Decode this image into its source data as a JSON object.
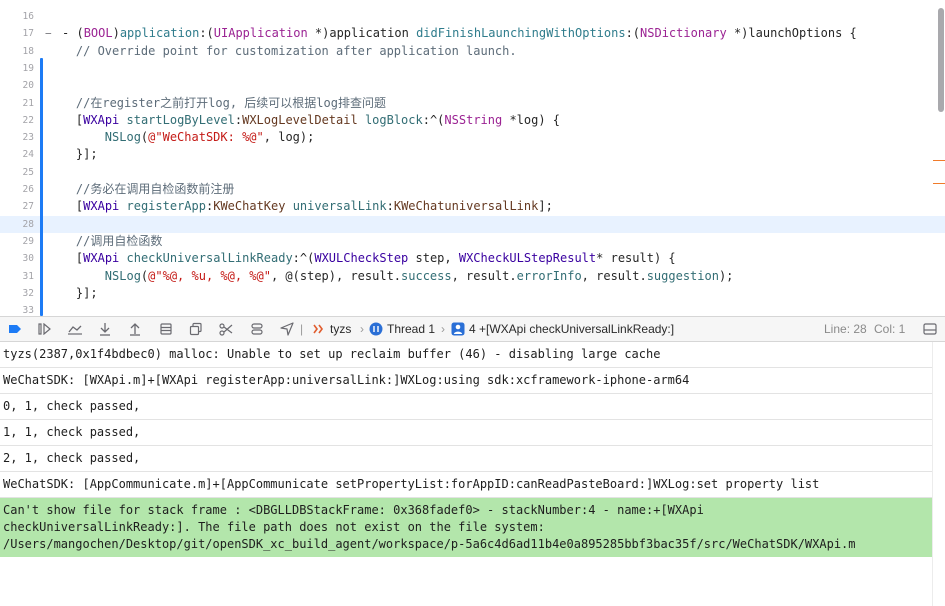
{
  "editor": {
    "lines": [
      {
        "num": "16",
        "html": ""
      },
      {
        "num": "17",
        "html": "<span class=\"p\">- (</span><span class=\"kw\">BOOL</span><span class=\"p\">)</span><span class=\"mth\">application</span><span class=\"p\">:(</span><span class=\"kw\">UIApplication</span><span class=\"p\"> *)application </span><span class=\"mth\">didFinishLaunchingWithOptions</span><span class=\"p\">:(</span><span class=\"kw\">NSDictionary</span><span class=\"p\"> *)launchOptions {</span>",
        "fold": "−"
      },
      {
        "num": "18",
        "html": "    <span class=\"cm\">// Override point for customization after application launch.</span>"
      },
      {
        "num": "19",
        "html": ""
      },
      {
        "num": "20",
        "html": ""
      },
      {
        "num": "21",
        "html": "    <span class=\"cm\">//在register之前打开log, 后续可以根据log排查问题</span>"
      },
      {
        "num": "22",
        "html": "    <span class=\"p\">[</span><span class=\"ty\">WXApi</span><span class=\"p\"> </span><span class=\"mth2\">startLogByLevel</span><span class=\"p\">:</span><span class=\"cst\">WXLogLevelDetail</span><span class=\"p\"> </span><span class=\"mth2\">logBlock</span><span class=\"p\">:^(</span><span class=\"kw\">NSString</span><span class=\"p\"> *log) {</span>"
      },
      {
        "num": "23",
        "html": "        <span class=\"mth2\">NSLog</span><span class=\"p\">(</span><span class=\"str\">@\"WeChatSDK: </span><span class=\"fmt\">%@</span><span class=\"str\">\"</span><span class=\"p\">, log);</span>"
      },
      {
        "num": "24",
        "html": "    <span class=\"p\">}];</span>"
      },
      {
        "num": "25",
        "html": ""
      },
      {
        "num": "26",
        "html": "    <span class=\"cm\">//务必在调用自检函数前注册</span>"
      },
      {
        "num": "27",
        "html": "    <span class=\"p\">[</span><span class=\"ty\">WXApi</span><span class=\"p\"> </span><span class=\"mth2\">registerApp</span><span class=\"p\">:</span><span class=\"cst\">KWeChatKey</span><span class=\"p\"> </span><span class=\"mth2\">universalLink</span><span class=\"p\">:</span><span class=\"cst\">KWeChatuniversalLink</span><span class=\"p\">];</span>"
      },
      {
        "num": "28",
        "html": "",
        "current": true
      },
      {
        "num": "29",
        "html": "    <span class=\"cm\">//调用自检函数</span>"
      },
      {
        "num": "30",
        "html": "    <span class=\"p\">[</span><span class=\"ty\">WXApi</span><span class=\"p\"> </span><span class=\"mth2\">checkUniversalLinkReady</span><span class=\"p\">:^(</span><span class=\"ty\">WXULCheckStep</span><span class=\"p\"> step, </span><span class=\"ty\">WXCheckULStepResult</span><span class=\"p\">* result) {</span>"
      },
      {
        "num": "31",
        "html": "        <span class=\"mth2\">NSLog</span><span class=\"p\">(</span><span class=\"str\">@\"%@, %u, %@, %@\"</span><span class=\"p\">, @(step), result.</span><span class=\"mth2\">success</span><span class=\"p\">, result.</span><span class=\"mth2\">errorInfo</span><span class=\"p\">, result.</span><span class=\"mth2\">suggestion</span><span class=\"p\">);</span>"
      },
      {
        "num": "32",
        "html": "    <span class=\"p\">}];</span>"
      },
      {
        "num": "33",
        "html": ""
      }
    ]
  },
  "debugbar": {
    "target": "tyzs",
    "thread": "Thread 1",
    "frame": "4 +[WXApi checkUniversalLinkReady:]",
    "line_label": "Line: 28",
    "col_label": "Col: 1"
  },
  "console": {
    "rows": [
      {
        "text": "tyzs(2387,0x1f4bdbec0) malloc: Unable to set up reclaim buffer (46) - disabling large cache"
      },
      {
        "text": "WeChatSDK: [WXApi.m]+[WXApi registerApp:universalLink:]WXLog:using sdk:xcframework-iphone-arm64"
      },
      {
        "text": "0, 1, check passed,"
      },
      {
        "text": "1, 1, check passed,"
      },
      {
        "text": "2, 1, check passed,"
      },
      {
        "text": "WeChatSDK: [AppCommunicate.m]+[AppCommunicate setPropertyList:forAppID:canReadPasteBoard:]WXLog:set property list"
      },
      {
        "text": "Can't show file for stack frame : <DBGLLDBStackFrame: 0x368fadef0> - stackNumber:4 - name:+[WXApi\ncheckUniversalLinkReady:]. The file path does not exist on the file system:\n/Users/mangochen/Desktop/git/openSDK_xc_build_agent/workspace/p-5a6c4d6ad11b4e0a895285bbf3bac35f/src/WeChatSDK/WXApi.m",
        "highlight": true
      }
    ]
  },
  "colors": {
    "change_bar": "#1d7bf5",
    "current_line": "#e8f2ff",
    "highlight_row": "#b3e6ab",
    "scroll_marks": "#f07b2a"
  }
}
